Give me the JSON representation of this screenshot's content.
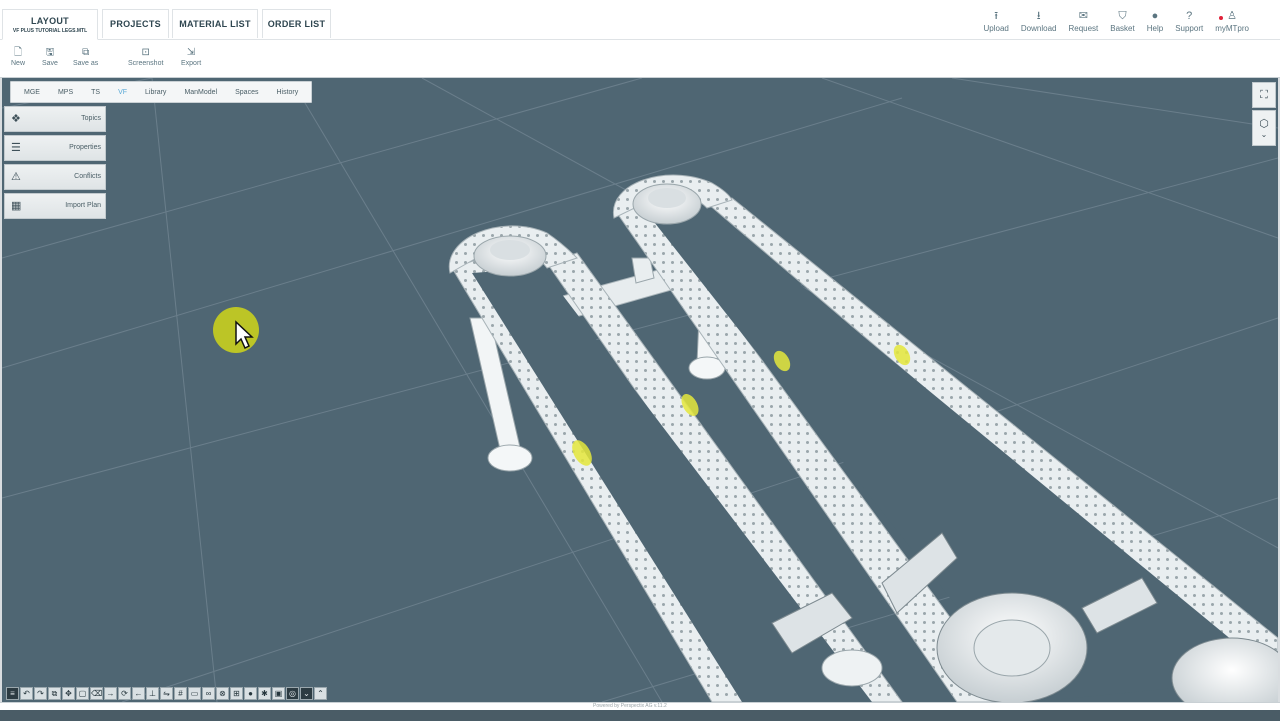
{
  "tabs": [
    {
      "label": "LAYOUT",
      "sub": "VF PLUS TUTORIAL LEGS.MTL",
      "active": true
    },
    {
      "label": "PROJECTS"
    },
    {
      "label": "MATERIAL LIST"
    },
    {
      "label": "ORDER LIST"
    }
  ],
  "top_actions": [
    {
      "label": "Upload",
      "icon": "upload-icon"
    },
    {
      "label": "Download",
      "icon": "download-icon"
    },
    {
      "label": "Request",
      "icon": "mail-icon"
    },
    {
      "label": "Basket",
      "icon": "basket-icon"
    },
    {
      "label": "Help",
      "icon": "info-icon"
    },
    {
      "label": "Support",
      "icon": "question-icon"
    },
    {
      "label": "myMTpro",
      "icon": "user-icon"
    }
  ],
  "toolbar": {
    "new": "New",
    "save": "Save",
    "save_as": "Save as",
    "screenshot": "Screenshot",
    "export": "Export"
  },
  "subtabs": [
    "MGE",
    "MPS",
    "TS",
    "VF",
    "Library",
    "ManModel",
    "Spaces",
    "History"
  ],
  "active_subtab": "VF",
  "side_panel": [
    "Topics",
    "Properties",
    "Conflicts",
    "Import Plan"
  ],
  "footer_text": "Powered by Perspectix AG v.11.2",
  "colors": {
    "viewport": "#4f6673",
    "accent": "#5aa9d6",
    "cursor_highlight": "#c8cf1e",
    "notification_dot": "#e0223a"
  }
}
